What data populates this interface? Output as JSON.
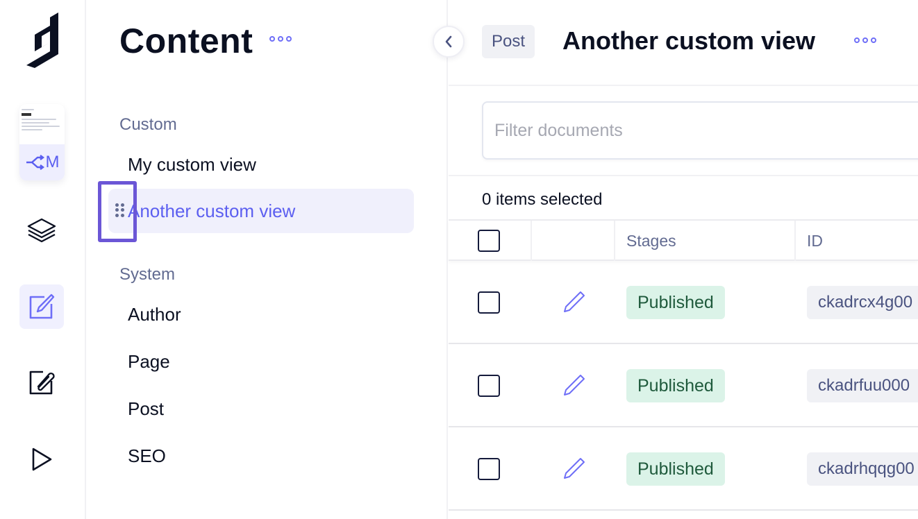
{
  "rail": {
    "items": [
      {
        "name": "logo",
        "icon": "hygraph-logo-icon"
      },
      {
        "name": "migration-preview",
        "icon": "migrate-icon",
        "label": "⥳M"
      },
      {
        "name": "schema",
        "icon": "layers-icon"
      },
      {
        "name": "content",
        "icon": "edit-square-icon",
        "active": true
      },
      {
        "name": "assets",
        "icon": "paperclip-square-icon"
      },
      {
        "name": "playground",
        "icon": "play-icon"
      }
    ]
  },
  "sidebar": {
    "title": "Content",
    "more_icon": "more-dots-icon",
    "groups": [
      {
        "label": "Custom",
        "items": [
          {
            "label": "My custom view",
            "active": false
          },
          {
            "label": "Another custom view",
            "active": true
          }
        ]
      },
      {
        "label": "System",
        "items": [
          {
            "label": "Author"
          },
          {
            "label": "Page"
          },
          {
            "label": "Post"
          },
          {
            "label": "SEO"
          }
        ]
      }
    ]
  },
  "collapse_icon": "chevron-left-icon",
  "main": {
    "model_badge": "Post",
    "view_title": "Another custom view",
    "filter_placeholder": "Filter documents",
    "selection_text": "0 items selected",
    "columns": [
      "",
      "",
      "Stages",
      "ID"
    ],
    "rows": [
      {
        "stage": "Published",
        "id": "ckadrcx4g00"
      },
      {
        "stage": "Published",
        "id": "ckadrfuu000"
      },
      {
        "stage": "Published",
        "id": "ckadrhqqg00"
      }
    ]
  },
  "colors": {
    "accent": "#5c5ff0",
    "active_bg": "#f0f0fc",
    "published_bg": "#dbf3e8",
    "published_text": "#1f5a3c",
    "focus_outline": "#6b56d6"
  }
}
